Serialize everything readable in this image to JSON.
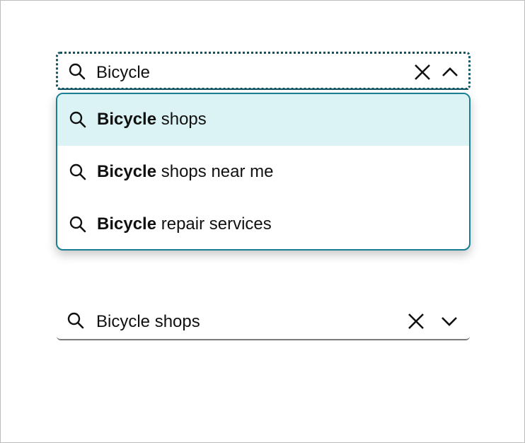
{
  "combobox_expanded": {
    "value": "Bicycle",
    "icons": {
      "search": "search-icon",
      "clear": "close-icon",
      "toggle": "chevron-up-icon"
    },
    "options": [
      {
        "match": "Bicycle",
        "rest": " shops",
        "highlighted": true
      },
      {
        "match": "Bicycle",
        "rest": " shops near me",
        "highlighted": false
      },
      {
        "match": "Bicycle",
        "rest": " repair services",
        "highlighted": false
      }
    ]
  },
  "combobox_collapsed": {
    "value": "Bicycle shops",
    "icons": {
      "search": "search-icon",
      "clear": "close-icon",
      "toggle": "chevron-down-icon"
    }
  },
  "colors": {
    "focus_outline": "#0e5561",
    "listbox_border": "#1a7f93",
    "highlight_bg": "#dbf3f4",
    "underline": "#7a7a7a"
  }
}
